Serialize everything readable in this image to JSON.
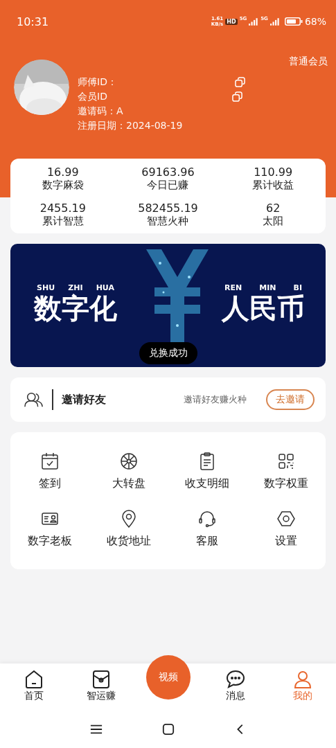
{
  "status_bar": {
    "time": "10:31",
    "speed": "1.61",
    "speed_unit": "KB/s",
    "hd": "HD",
    "network_1": "5G",
    "network_2": "5G",
    "battery": "68%"
  },
  "profile": {
    "member_level": "普通会员",
    "fields": [
      {
        "label": "师傅ID：",
        "copyable": true
      },
      {
        "label": "会员ID",
        "copyable": true
      },
      {
        "label": "邀请码：A",
        "copyable": false
      },
      {
        "label": "注册日期：",
        "value": "2024-08-19",
        "copyable": false
      }
    ]
  },
  "stats": [
    {
      "value": "16.99",
      "label": "数字麻袋"
    },
    {
      "value": "69163.96",
      "label": "今日已赚"
    },
    {
      "value": "110.99",
      "label": "累计收益"
    },
    {
      "value": "2455.19",
      "label": "累计智慧"
    },
    {
      "value": "582455.19",
      "label": "智慧火种"
    },
    {
      "value": "62",
      "label": "太阳"
    }
  ],
  "banner": {
    "left_pinyin": [
      "SHU",
      "ZHI",
      "HUA"
    ],
    "left_title": "数字化",
    "right_pinyin": [
      "REN",
      "MIN",
      "BI"
    ],
    "right_title": "人民币",
    "toast": "兑换成功"
  },
  "invite": {
    "title": "邀请好友",
    "hint": "邀请好友赚火种",
    "button": "去邀请"
  },
  "menu": [
    {
      "kind": "calendar",
      "label": "签到"
    },
    {
      "kind": "wheel",
      "label": "大转盘"
    },
    {
      "kind": "clipboard",
      "label": "收支明细"
    },
    {
      "kind": "qr",
      "label": "数字权重"
    },
    {
      "kind": "card",
      "label": "数字老板"
    },
    {
      "kind": "pin",
      "label": "收货地址"
    },
    {
      "kind": "headset",
      "label": "客服"
    },
    {
      "kind": "hexagon",
      "label": "设置"
    }
  ],
  "tab_bar": [
    {
      "kind": "home",
      "label": "首页",
      "selected": false
    },
    {
      "kind": "bag",
      "label": "智运赚",
      "selected": false
    },
    {
      "kind": "center",
      "label": "视频",
      "selected": false
    },
    {
      "kind": "chat",
      "label": "消息",
      "selected": false
    },
    {
      "kind": "person",
      "label": "我的",
      "selected": true
    }
  ]
}
